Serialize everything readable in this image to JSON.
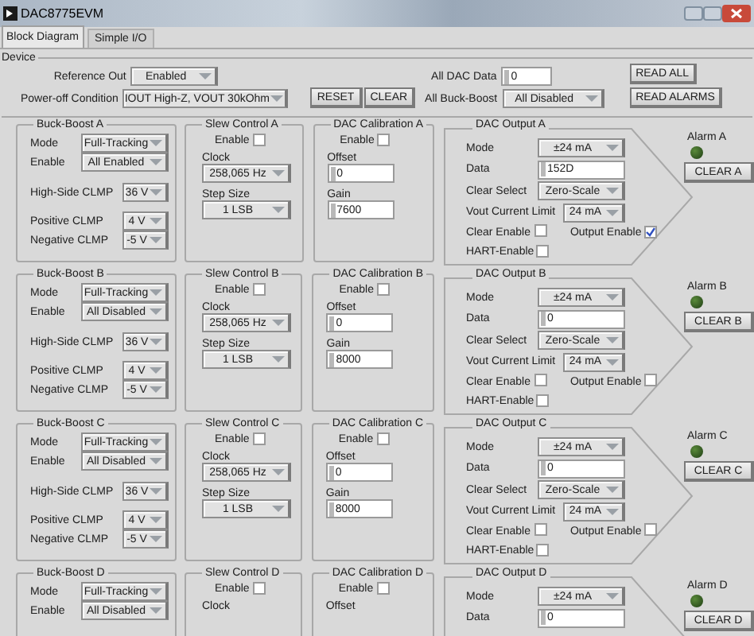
{
  "window": {
    "title": "DAC8775EVM"
  },
  "tabs": [
    {
      "label": "Block Diagram",
      "selected": true
    },
    {
      "label": "Simple I/O",
      "selected": false
    }
  ],
  "device": {
    "title": "Device",
    "reference_out": {
      "label": "Reference Out",
      "value": "Enabled"
    },
    "power_off": {
      "label": "Power-off Condition",
      "value": "IOUT High-Z, VOUT 30kOhm"
    },
    "reset": "RESET",
    "clear": "CLEAR",
    "all_dac_data": {
      "label": "All DAC Data",
      "value": "0"
    },
    "all_buck_boost": {
      "label": "All Buck-Boost",
      "value": "All Disabled"
    },
    "read_all": "READ ALL",
    "read_alarms": "READ ALARMS"
  },
  "channels": [
    {
      "buck_boost": {
        "title": "Buck-Boost A",
        "fields": [
          {
            "label": "Mode",
            "value": "Full-Tracking"
          },
          {
            "label": "Enable",
            "value": "All Enabled"
          },
          {
            "label": "High-Side CLMP",
            "value": "36 V"
          },
          {
            "label": "Positive CLMP",
            "value": "4 V"
          },
          {
            "label": "Negative CLMP",
            "value": "-5 V"
          }
        ]
      },
      "slew": {
        "title": "Slew Control A",
        "enable": {
          "label": "Enable",
          "checked": false
        },
        "clock": {
          "label": "Clock",
          "value": "258,065 Hz"
        },
        "step": {
          "label": "Step Size",
          "value": "1 LSB"
        }
      },
      "calibration": {
        "title": "DAC Calibration A",
        "enable": {
          "label": "Enable",
          "checked": false
        },
        "offset": {
          "label": "Offset",
          "value": "0"
        },
        "gain": {
          "label": "Gain",
          "value": "7600"
        }
      },
      "output": {
        "title": "DAC Output A",
        "mode": {
          "label": "Mode",
          "value": "±24 mA"
        },
        "data": {
          "label": "Data",
          "value": "152D"
        },
        "clear_select": {
          "label": "Clear Select",
          "value": "Zero-Scale"
        },
        "current_limit": {
          "label": "Vout Current Limit",
          "value": "24 mA"
        },
        "clear_enable": {
          "label": "Clear Enable",
          "checked": false
        },
        "output_enable": {
          "label": "Output Enable",
          "checked": true
        },
        "hart_enable": {
          "label": "HART-Enable",
          "checked": false
        }
      },
      "alarm": {
        "label": "Alarm A",
        "button": "CLEAR A"
      }
    },
    {
      "buck_boost": {
        "title": "Buck-Boost B",
        "fields": [
          {
            "label": "Mode",
            "value": "Full-Tracking"
          },
          {
            "label": "Enable",
            "value": "All Disabled"
          },
          {
            "label": "High-Side CLMP",
            "value": "36 V"
          },
          {
            "label": "Positive CLMP",
            "value": "4 V"
          },
          {
            "label": "Negative CLMP",
            "value": "-5 V"
          }
        ]
      },
      "slew": {
        "title": "Slew Control B",
        "enable": {
          "label": "Enable",
          "checked": false
        },
        "clock": {
          "label": "Clock",
          "value": "258,065 Hz"
        },
        "step": {
          "label": "Step Size",
          "value": "1 LSB"
        }
      },
      "calibration": {
        "title": "DAC Calibration B",
        "enable": {
          "label": "Enable",
          "checked": false
        },
        "offset": {
          "label": "Offset",
          "value": "0"
        },
        "gain": {
          "label": "Gain",
          "value": "8000"
        }
      },
      "output": {
        "title": "DAC Output B",
        "mode": {
          "label": "Mode",
          "value": "±24 mA"
        },
        "data": {
          "label": "Data",
          "value": "0"
        },
        "clear_select": {
          "label": "Clear Select",
          "value": "Zero-Scale"
        },
        "current_limit": {
          "label": "Vout Current Limit",
          "value": "24 mA"
        },
        "clear_enable": {
          "label": "Clear Enable",
          "checked": false
        },
        "output_enable": {
          "label": "Output Enable",
          "checked": false
        },
        "hart_enable": {
          "label": "HART-Enable",
          "checked": false
        }
      },
      "alarm": {
        "label": "Alarm B",
        "button": "CLEAR B"
      }
    },
    {
      "buck_boost": {
        "title": "Buck-Boost C",
        "fields": [
          {
            "label": "Mode",
            "value": "Full-Tracking"
          },
          {
            "label": "Enable",
            "value": "All Disabled"
          },
          {
            "label": "High-Side CLMP",
            "value": "36 V"
          },
          {
            "label": "Positive CLMP",
            "value": "4 V"
          },
          {
            "label": "Negative CLMP",
            "value": "-5 V"
          }
        ]
      },
      "slew": {
        "title": "Slew Control C",
        "enable": {
          "label": "Enable",
          "checked": false
        },
        "clock": {
          "label": "Clock",
          "value": "258,065 Hz"
        },
        "step": {
          "label": "Step Size",
          "value": "1 LSB"
        }
      },
      "calibration": {
        "title": "DAC Calibration C",
        "enable": {
          "label": "Enable",
          "checked": false
        },
        "offset": {
          "label": "Offset",
          "value": "0"
        },
        "gain": {
          "label": "Gain",
          "value": "8000"
        }
      },
      "output": {
        "title": "DAC Output C",
        "mode": {
          "label": "Mode",
          "value": "±24 mA"
        },
        "data": {
          "label": "Data",
          "value": "0"
        },
        "clear_select": {
          "label": "Clear Select",
          "value": "Zero-Scale"
        },
        "current_limit": {
          "label": "Vout Current Limit",
          "value": "24 mA"
        },
        "clear_enable": {
          "label": "Clear Enable",
          "checked": false
        },
        "output_enable": {
          "label": "Output Enable",
          "checked": false
        },
        "hart_enable": {
          "label": "HART-Enable",
          "checked": false
        }
      },
      "alarm": {
        "label": "Alarm C",
        "button": "CLEAR C"
      }
    },
    {
      "buck_boost": {
        "title": "Buck-Boost D",
        "fields": [
          {
            "label": "Mode",
            "value": "Full-Tracking"
          },
          {
            "label": "Enable",
            "value": "All Disabled"
          }
        ]
      },
      "slew": {
        "title": "Slew Control D",
        "enable": {
          "label": "Enable",
          "checked": false
        },
        "clock": {
          "label": "Clock"
        }
      },
      "calibration": {
        "title": "DAC Calibration D",
        "enable": {
          "label": "Enable",
          "checked": false
        },
        "offset": {
          "label": "Offset"
        }
      },
      "output": {
        "title": "DAC Output D",
        "mode": {
          "label": "Mode",
          "value": "±24 mA"
        },
        "data": {
          "label": "Data",
          "value": "0"
        }
      },
      "alarm": {
        "label": "Alarm D",
        "button": "CLEAR D"
      }
    }
  ]
}
